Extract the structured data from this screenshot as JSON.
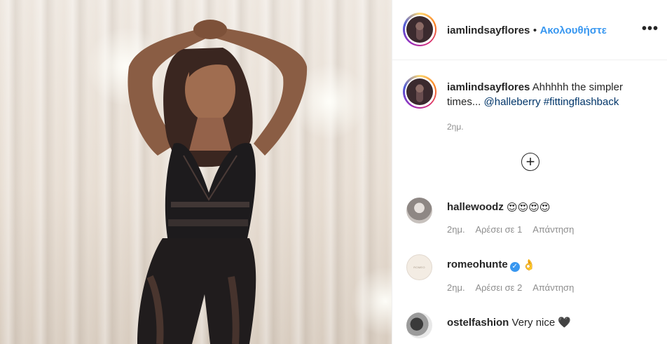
{
  "post": {
    "username": "iamlindsayflores",
    "separator": "•",
    "follow_label": "Ακολουθήστε",
    "more_label": "•••",
    "caption_user": "iamlindsayflores",
    "caption_text": "Ahhhhh the simpler times...",
    "caption_mention": "@halleberry",
    "caption_hashtag": "#fittingflashback",
    "caption_time": "2ημ.",
    "load_more_label": "+"
  },
  "comments": [
    {
      "user": "hallewoodz",
      "text": "😍😍😍😍",
      "time": "2ημ.",
      "likes": "Αρέσει σε 1",
      "reply": "Απάντηση",
      "verified": false
    },
    {
      "user": "romeohunte",
      "text": "👌",
      "time": "2ημ.",
      "likes": "Αρέσει σε 2",
      "reply": "Απάντηση",
      "verified": true
    },
    {
      "user": "ostelfashion",
      "text": "Very nice 🖤",
      "time": "",
      "likes": "",
      "reply": "",
      "verified": false
    }
  ],
  "icons": {
    "more": "more-options-icon",
    "load_more": "plus-circle-icon",
    "verified": "verified-badge-icon"
  },
  "colors": {
    "link_blue": "#3897f0",
    "mention_blue": "#003569",
    "meta_gray": "#8e8e8e",
    "text": "#262626",
    "divider": "#efefef"
  }
}
